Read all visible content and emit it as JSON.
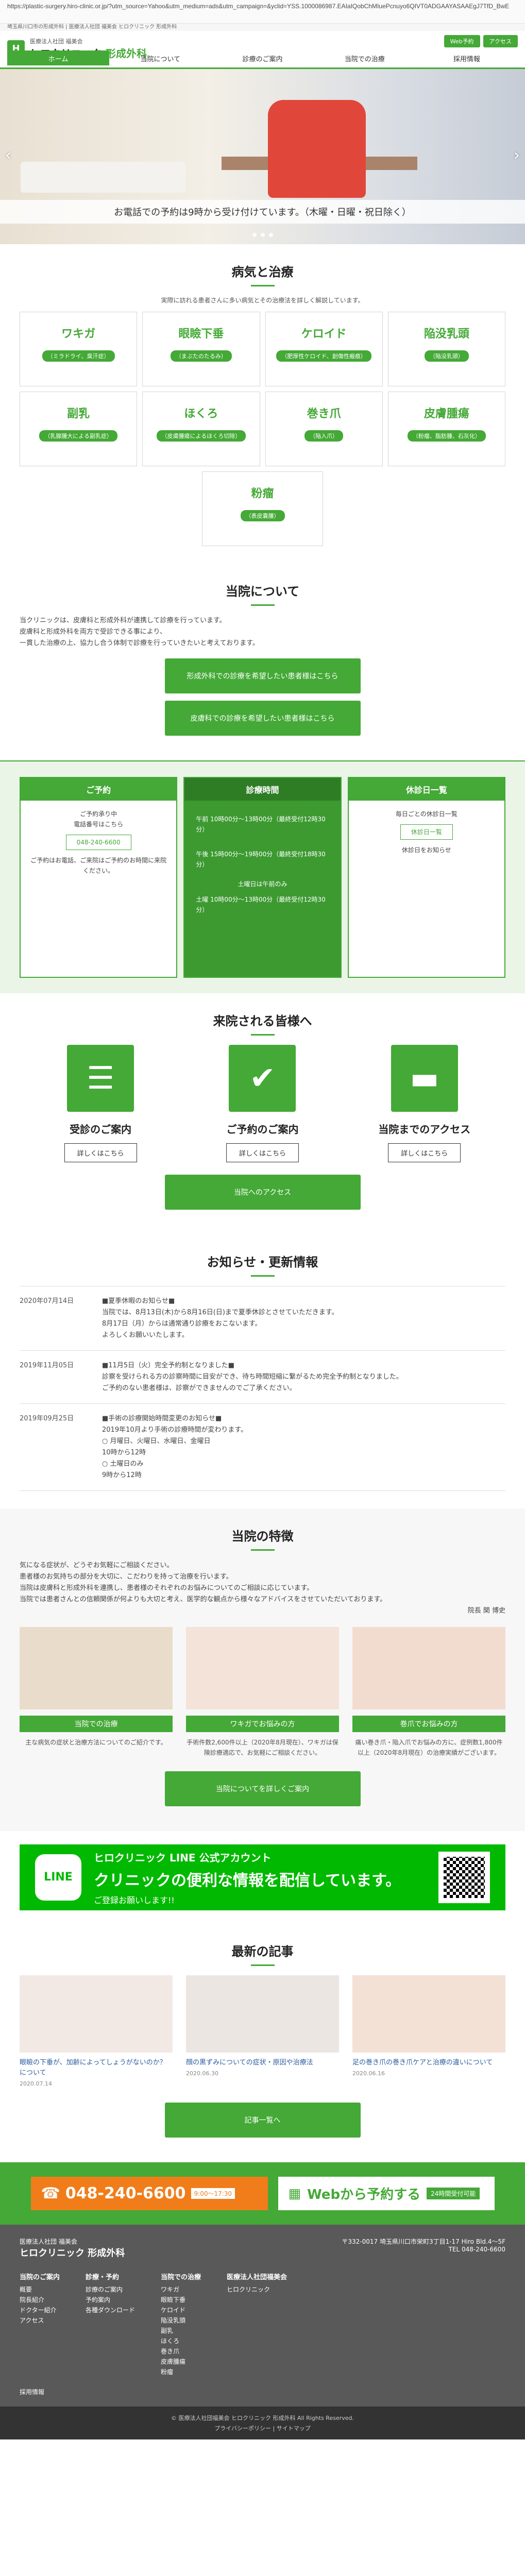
{
  "browser": {
    "url": "https://plastic-surgery.hiro-clinic.or.jp/?utm_source=Yahoo&utm_medium=ads&utm_campaign=&yclid=YSS.1000086987.EAIaIQobChMIuePcnuyo6QIVT0ADGAAYASAAEgJ7TfD_BwE"
  },
  "topstrip": {
    "text": "埼玉県川口市の形成外科 | 医療法人社団 福美会 ヒロクリニック 形成外科"
  },
  "header": {
    "logo_sub": "医療法人社団 福美会",
    "logo_name": "ヒロクリニック",
    "logo_name_green": "形成外科",
    "web_reserve": "Web予約",
    "access": "アクセス",
    "nav": [
      {
        "label": "ホーム"
      },
      {
        "label": "当院について"
      },
      {
        "label": "診療のご案内"
      },
      {
        "label": "当院での治療"
      },
      {
        "label": "採用情報"
      }
    ]
  },
  "hero": {
    "caption": "お電話での予約は9時から受け付けています。（木曜・日曜・祝日除く）"
  },
  "diseases": {
    "title": "病気と治療",
    "lead": "実際に訪れる患者さんに多い病気とその治療法を詳しく解説しています。",
    "items": [
      {
        "name": "ワキガ",
        "tag": "（ミラドライ、臭汗症）"
      },
      {
        "name": "眼瞼下垂",
        "tag": "（まぶたのたるみ）"
      },
      {
        "name": "ケロイド",
        "tag": "（肥厚性ケロイド、創傷性瘢痕）"
      },
      {
        "name": "陥没乳頭",
        "tag": "（陥没乳頭）"
      },
      {
        "name": "副乳",
        "tag": "（乳腺腫大による副乳症）"
      },
      {
        "name": "ほくろ",
        "tag": "（皮膚腫瘍によるほくろ切除）"
      },
      {
        "name": "巻き爪",
        "tag": "（陥入爪）"
      },
      {
        "name": "皮膚腫瘍",
        "tag": "（粉瘤、脂肪腫、石灰化）"
      },
      {
        "name": "粉瘤",
        "tag": "（表皮嚢腫）"
      }
    ]
  },
  "about": {
    "title": "当院について",
    "paragraphs": [
      "当クリニックは、皮膚科と形成外科が連携して診療を行っています。",
      "皮膚科と形成外科を両方で受診できる事により、",
      "一貫した治療の上、協力し合う体制で診療を行っていきたいと考えております。"
    ],
    "btn_first": "形成外科での診療を希望したい患者様はこちら",
    "btn_second": "皮膚科での診療を希望したい患者様はこちら"
  },
  "info": {
    "cols": [
      {
        "head": "ご予約",
        "lines": [
          "ご予約承り中",
          "電話番号はこちら"
        ],
        "phone": "048-240-6600",
        "note": "ご予約はお電話、ご来院はご予約のお時間に来院ください。"
      },
      {
        "head": "診療時間",
        "morning": "午前 10時00分〜13時00分（最終受付12時30分）",
        "afternoon": "午後 15時00分〜19時00分（最終受付18時30分）",
        "note": "土曜日は午前のみ",
        "saturday": "土曜 10時00分〜13時00分（最終受付12時30分）"
      },
      {
        "head": "休診日一覧",
        "lines": [
          "毎日ごとの休診日一覧"
        ],
        "btn": "休診日一覧",
        "note": "休診日をお知らせ"
      }
    ]
  },
  "visitors": {
    "title": "来院される皆様へ",
    "items": [
      {
        "title": "受診のご案内",
        "btn": "詳しくはこちら",
        "icon": "document-icon"
      },
      {
        "title": "ご予約のご案内",
        "btn": "詳しくはこちら",
        "icon": "reserve-icon"
      },
      {
        "title": "当院までのアクセス",
        "btn": "詳しくはこちら",
        "icon": "car-icon"
      }
    ],
    "access_btn": "当院へのアクセス"
  },
  "news": {
    "title": "お知らせ・更新情報",
    "items": [
      {
        "date": "2020年07月14日",
        "body": "■夏季休暇のお知らせ■\n当院では、8月13日(木)から8月16日(日)まで夏季休診とさせていただきます。\n8月17日（月）からは通常通り診療をおこないます。\nよろしくお願いいたします。"
      },
      {
        "date": "2019年11月05日",
        "body": "■11月5日（火）完全予約制となりました■\n診察を受けられる方の診察時間に目安ができ、待ち時間短縮に繋がるため完全予約制となりました。\nご予約のない患者様は、診察ができませんのでご了承ください。"
      },
      {
        "date": "2019年09月25日",
        "body": "■手術の診療開始時間変更のお知らせ■\n2019年10月より手術の診療時間が変わります。\n○ 月曜日、火曜日、水曜日、金曜日\n10時から12時\n○ 土曜日のみ\n9時から12時"
      }
    ]
  },
  "features": {
    "title": "当院の特徴",
    "paragraphs": [
      "気になる症状が、どうぞお気軽にご相談ください。",
      "患者様のお気持ちの部分を大切に、こだわりを持って治療を行います。",
      "当院は皮膚科と形成外科を連携し、患者様のそれぞれのお悩みについてのご相談に応じています。",
      "当院では患者さんとの信頼関係が何よりも大切と考え、医学的な観点から様々なアドバイスをさせていただいております。"
    ],
    "author": "院長 関 博史",
    "items": [
      {
        "caption": "当院での治療",
        "text": "主な病気の症状と治療方法についてのご紹介です。"
      },
      {
        "caption": "ワキガでお悩みの方",
        "text": "手術件数2,600件以上（2020年8月現在）、ワキガは保険診療適応で、お気軽にご相談ください。"
      },
      {
        "caption": "巻爪でお悩みの方",
        "text": "痛い巻き爪・陥入爪でお悩みの方に、症例数1,800件以上（2020年8月現在）の治療実績がございます。"
      }
    ],
    "btn": "当院についてを詳しくご案内"
  },
  "line_banner": {
    "logo": "LINE",
    "t1": "ヒロクリニック LINE 公式アカウント",
    "t2": "クリニックの便利な情報を配信しています。",
    "t3": "ご登録お願いします!!"
  },
  "articles": {
    "title": "最新の記事",
    "items": [
      {
        "title": "眼瞼の下垂が、加齢によってしょうがないのか？について",
        "date": "2020.07.14"
      },
      {
        "title": "顔の黒ずみについての症状・原因や治療法",
        "date": "2020.06.30"
      },
      {
        "title": "足の巻き爪の巻き爪ケアと治療の違いについて",
        "date": "2020.06.16"
      }
    ],
    "btn": "記事一覧へ"
  },
  "contact": {
    "phone": "048-240-6600",
    "hours": "9:00〜17:30",
    "web": "Webから予約する",
    "web_badge": "24時間受付可能"
  },
  "footer": {
    "name_small": "医療法人社団 福美会",
    "name": "ヒロクリニック 形成外科",
    "address": "〒332-0017 埼玉県川口市栄町3丁目1-17 Hiro Bld.4〜5F",
    "tel": "TEL 048-240-6600",
    "col1": {
      "head": "当院のご案内",
      "items": [
        "概要",
        "院長紹介",
        "ドクター紹介",
        "アクセス"
      ]
    },
    "col2": {
      "head": "診療・予約",
      "items": [
        "診療のご案内",
        "予約案内",
        "各種ダウンロード"
      ]
    },
    "col3": {
      "head": "当院での治療",
      "items": [
        "ワキガ",
        "眼瞼下垂",
        "ケロイド",
        "陥没乳頭",
        "副乳",
        "ほくろ",
        "巻き爪",
        "皮膚腫瘍",
        "粉瘤"
      ]
    },
    "col4": {
      "head": "医療法人社団福美会",
      "items": [
        "ヒロクリニック"
      ]
    },
    "recruit": "採用情報",
    "copyright": "© 医療法人社団福美会 ヒロクリニック 形成外科 All Rights Reserved.",
    "policy": "プライバシーポリシー | サイトマップ"
  }
}
